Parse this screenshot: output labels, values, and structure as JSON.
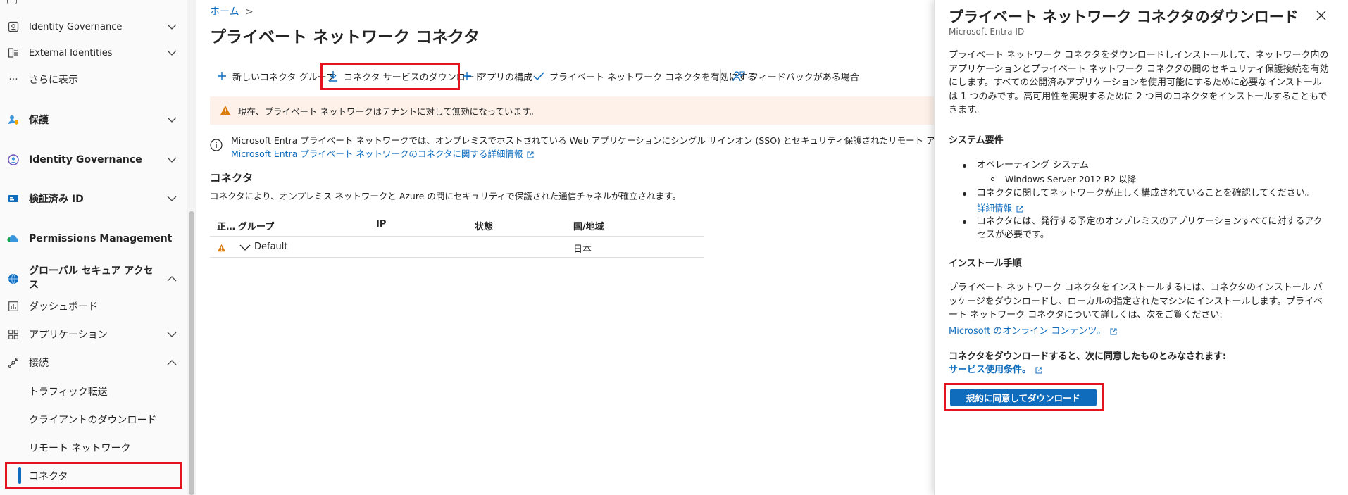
{
  "sidebar": {
    "items": [
      {
        "label": "Identity Governance",
        "icon": "identity-governance-icon"
      },
      {
        "label": "External Identities",
        "icon": "external-identities-icon"
      },
      {
        "label": "さらに表示",
        "icon": "more-icon"
      },
      {
        "label": "保護",
        "icon": "protection-icon"
      },
      {
        "label": "Identity Governance",
        "icon": "identity-governance-icon"
      },
      {
        "label": "検証済み ID",
        "icon": "verified-id-icon"
      },
      {
        "label": "Permissions Management",
        "icon": "cloud-icon"
      },
      {
        "label": "グローバル セキュア アクセス",
        "icon": "globe-icon"
      },
      {
        "label": "ダッシュボード",
        "icon": "dashboard-icon"
      },
      {
        "label": "アプリケーション",
        "icon": "applications-icon"
      },
      {
        "label": "接続",
        "icon": "connect-icon"
      }
    ],
    "subitems": [
      "トラフィック転送",
      "クライアントのダウンロード",
      "リモート ネットワーク",
      "コネクタ"
    ]
  },
  "breadcrumb": {
    "home": "ホーム",
    "separator": ">"
  },
  "page": {
    "title": "プライベート ネットワーク コネクタ",
    "more": "…"
  },
  "toolbar": {
    "new_group": "新しいコネクタ グループ",
    "download": "コネクタ サービスのダウンロード",
    "configure": "アプリの構成",
    "enable": "プライベート ネットワーク コネクタを有効にする",
    "feedback": "フィードバックがある場合"
  },
  "warning": {
    "text": "現在、プライベート ネットワークはテナントに対して無効になっています。"
  },
  "info": {
    "text": "Microsoft Entra プライベート ネットワークでは、オンプレミスでホストされている Web アプリケーションにシングル サインオン (SSO) とセキュリティ保護されたリモート アクセスが提供されます。",
    "link": "Microsoft Entra プライベート ネットワークのコネクタに関する詳細情報"
  },
  "connectors": {
    "title": "コネクタ",
    "desc": "コネクタにより、オンプレミス ネットワークと Azure の間にセキュリティで保護された通信チャネルが確立されます。",
    "columns": [
      "正…",
      "グループ",
      "IP",
      "状態",
      "国/地域"
    ],
    "rows": [
      {
        "group": "Default",
        "ip": "",
        "status": "",
        "country": "日本"
      }
    ]
  },
  "panel": {
    "title": "プライベート ネットワーク コネクタのダウンロード",
    "subtitle": "Microsoft Entra ID",
    "intro": "プライベート ネットワーク コネクタをダウンロードしインストールして、ネットワーク内のアプリケーションとプライベート ネットワーク コネクタの間のセキュリティ保護接続を有効にします。すべての公開済みアプリケーションを使用可能にするために必要なインストールは 1 つのみです。高可用性を実現するために 2 つ目のコネクタをインストールすることもできます。",
    "sysreq_title": "システム要件",
    "req1": "オペレーティング システム",
    "req1_sub": "Windows Server 2012 R2 以降",
    "req2": "コネクタに関してネットワークが正しく構成されていることを確認してください。",
    "req2_link": "詳細情報",
    "req3": "コネクタには、発行する予定のオンプレミスのアプリケーションすべてに対するアクセスが必要です。",
    "install_title": "インストール手順",
    "install_text": "プライベート ネットワーク コネクタをインストールするには、コネクタのインストール パッケージをダウンロードし、ローカルの指定されたマシンにインストールします。プライベート ネットワーク コネクタについて詳しくは、次をご覧ください:",
    "install_link": "Microsoft のオンライン コンテンツ。",
    "agree_text": "コネクタをダウンロードすると、次に同意したものとみなされます:",
    "terms_link": "サービス使用条件。",
    "button": "規約に同意してダウンロード"
  }
}
